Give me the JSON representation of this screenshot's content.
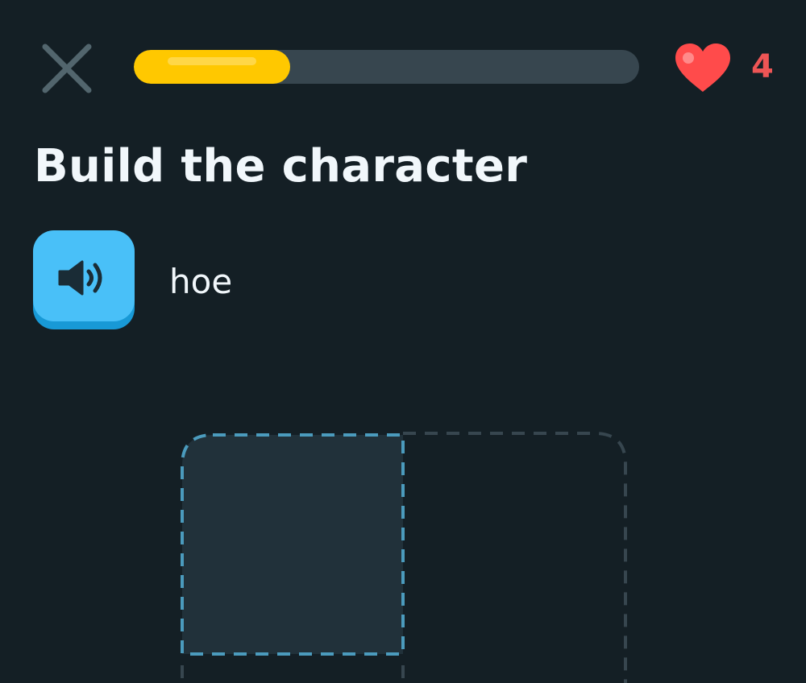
{
  "header": {
    "close_icon": "close-icon",
    "progress": 0.31,
    "progress_color": "#ffc800",
    "track_color": "#37464f",
    "heart_icon": "heart-icon",
    "hearts_count": "4",
    "hearts_color": "#ee5555"
  },
  "exercise": {
    "title": "Build the character",
    "audio_icon": "speaker-icon",
    "audio_button_color": "#49c0f8",
    "prompt_word": "hoe"
  },
  "character_grid": {
    "cells": [
      "top-left",
      "top-right",
      "bottom-left",
      "bottom-right"
    ],
    "active_cell": "top-left",
    "active_border_color": "#4b9bbd",
    "inactive_border_color": "#37464f"
  }
}
